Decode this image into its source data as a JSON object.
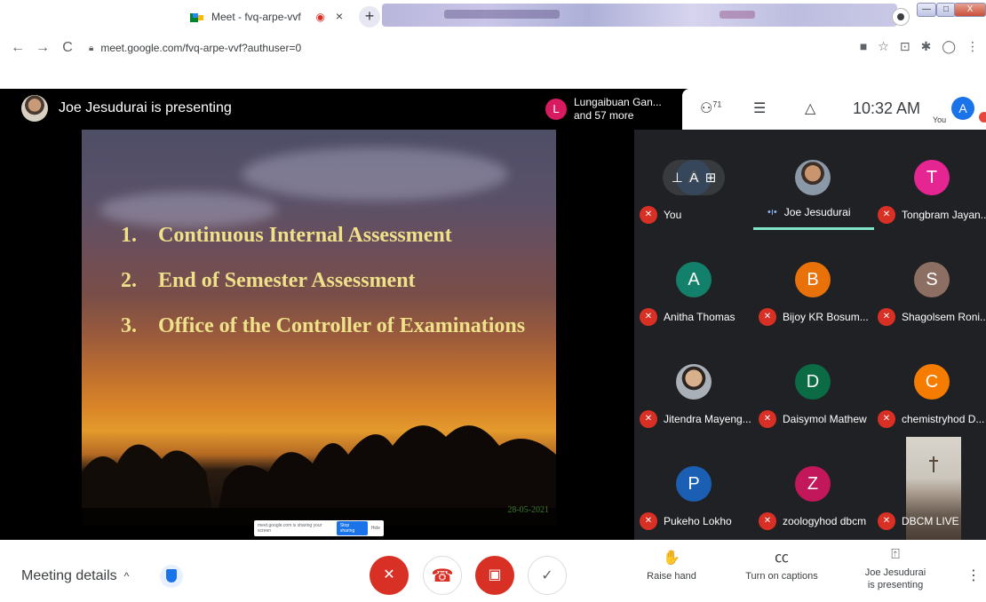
{
  "browser": {
    "tab_title": "Meet - fvq-arpe-vvf",
    "tab_close": "×",
    "new_tab": "+",
    "url": "meet.google.com/fvq-arpe-vvf?authuser=0",
    "back": "←",
    "forward": "→",
    "reload": "C",
    "win_min": "—",
    "win_max": "□",
    "win_close": "X"
  },
  "meet": {
    "presenting": "Joe Jesudurai is presenting",
    "others_avatar": "L",
    "others_line1": "Lungaibuan Gan...",
    "others_line2": "and 57 more",
    "people_count": "71",
    "time": "10:32 AM",
    "you_label": "You",
    "you_avatar": "A"
  },
  "slide": {
    "items": [
      {
        "num": "1.",
        "text": "Continuous Internal Assessment"
      },
      {
        "num": "2.",
        "text": "End of Semester Assessment"
      },
      {
        "num": "3.",
        "text": "Office of the Controller of Examinations"
      }
    ],
    "date": "28-05-2021",
    "share_text": "meet.google.com is sharing your screen",
    "share_stop": "Stop sharing",
    "share_hide": "Hide"
  },
  "participants": [
    {
      "name": "You",
      "initial": "A",
      "color": "#1a73e8"
    },
    {
      "name": "Joe Jesudurai",
      "initial": "",
      "color": ""
    },
    {
      "name": "Tongbram Jayan...",
      "initial": "T",
      "color": "#e52592"
    },
    {
      "name": "Anitha Thomas",
      "initial": "A",
      "color": "#12806a"
    },
    {
      "name": "Bijoy KR Bosum...",
      "initial": "B",
      "color": "#e8710a"
    },
    {
      "name": "Shagolsem Roni...",
      "initial": "S",
      "color": "#8d6e63"
    },
    {
      "name": "Jitendra Mayeng...",
      "initial": "",
      "color": ""
    },
    {
      "name": "Daisymol Mathew",
      "initial": "D",
      "color": "#0b6b45"
    },
    {
      "name": "chemistryhod D...",
      "initial": "C",
      "color": "#f57c00"
    },
    {
      "name": "Pukeho Lokho",
      "initial": "P",
      "color": "#1a5fb4"
    },
    {
      "name": "zoologyhod dbcm",
      "initial": "Z",
      "color": "#c2185b"
    },
    {
      "name": "DBCM LIVE",
      "initial": "",
      "color": ""
    }
  ],
  "bottom": {
    "meeting_details": "Meeting details",
    "caret": "^",
    "raise_hand": "Raise hand",
    "captions": "Turn on captions",
    "presenting_line1": "Joe Jesudurai",
    "presenting_line2": "is presenting"
  },
  "icons": {
    "mic_off": "mic-off-icon",
    "hangup": "call-end-icon",
    "cam_off": "videocam-off-icon",
    "present": "present-icon",
    "more": "more-vert-icon"
  }
}
